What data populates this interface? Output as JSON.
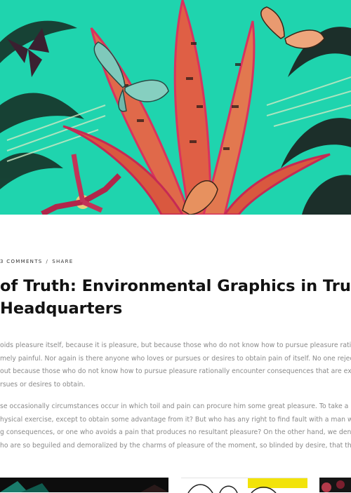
{
  "hero": {
    "alt": "tropical botanical illustration with butterflies and orchids"
  },
  "post": {
    "meta": {
      "comments": "3 COMMENTS",
      "separator": "/",
      "share": "SHARE"
    },
    "title_lines": [
      "of Truth: Environmental Graphics in Tru",
      "Headquarters"
    ],
    "paragraph1": [
      "oids pleasure itself, because it is pleasure, but because those who do not know how to pursue pleasure ration",
      "mely painful. Nor again is there anyone who loves or pursues or desires to obtain pain of itself. No one rejects",
      "out because those who do not know how to pursue pleasure rationally encounter consequences that are extr",
      "rsues or desires to obtain."
    ],
    "paragraph2": [
      "se occasionally circumstances occur in which toil and pain can procure him some great pleasure. To take a",
      "hysical exercise, except to obtain some advantage from it? But who has any right to find fault with a man who",
      "g consequences, or one who avoids a pain that produces no resultant pleasure? On the other hand, we den",
      "ho are so beguiled and demoralized by the charms of pleasure of the moment, so blinded by desire, that th"
    ]
  },
  "colors": {
    "hero_bg": "#1fd4ae",
    "leaf_pink": "#e2456e",
    "leaf_orange": "#e0694a",
    "butterfly_teal": "#78c4b8",
    "butterfly_orange": "#e99a70"
  }
}
